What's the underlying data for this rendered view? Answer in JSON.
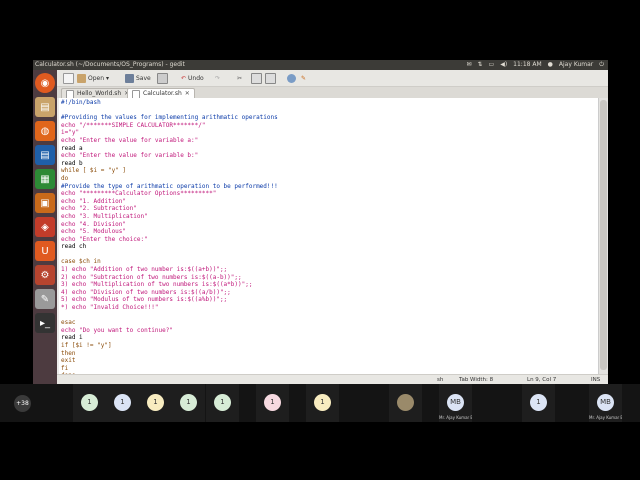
{
  "window": {
    "title": "Calculator.sh (~/Documents/OS_Programs) - gedit",
    "clock": "11:18 AM",
    "user": "Ajay Kumar"
  },
  "toolbar": {
    "open_label": "Open",
    "save_label": "Save",
    "undo_label": "Undo"
  },
  "tabs": [
    {
      "label": "Hello_World.sh"
    },
    {
      "label": "Calculator.sh"
    }
  ],
  "code_lines": [
    {
      "text": "#!/bin/bash",
      "cls": "c"
    },
    {
      "text": "",
      "cls": ""
    },
    {
      "text": "#Providing the values for implementing arithmatic operations",
      "cls": "c"
    },
    {
      "text": "echo \"/*******SIMPLE CALCULATOR*******/\"",
      "cls": "s"
    },
    {
      "text": "i=\"y\"",
      "cls": "s"
    },
    {
      "text": "echo \"Enter the value for variable a:\"",
      "cls": "s"
    },
    {
      "text": "read a",
      "cls": ""
    },
    {
      "text": "echo \"Enter the value for variable b:\"",
      "cls": "s"
    },
    {
      "text": "read b",
      "cls": ""
    },
    {
      "text": "while [ $i = \"y\" ]",
      "cls": "k"
    },
    {
      "text": "do",
      "cls": "k"
    },
    {
      "text": "#Provide the type of arithmatic operation to be performed!!!",
      "cls": "c"
    },
    {
      "text": "echo \"*********Calculator Options*********\"",
      "cls": "s"
    },
    {
      "text": "echo \"1. Addition\"",
      "cls": "s"
    },
    {
      "text": "echo \"2. Subtraction\"",
      "cls": "s"
    },
    {
      "text": "echo \"3. Multiplication\"",
      "cls": "s"
    },
    {
      "text": "echo \"4. Division\"",
      "cls": "s"
    },
    {
      "text": "echo \"5. Modulous\"",
      "cls": "s"
    },
    {
      "text": "echo \"Enter the choice:\"",
      "cls": "s"
    },
    {
      "text": "read ch",
      "cls": ""
    },
    {
      "text": "",
      "cls": ""
    },
    {
      "text": "case $ch in",
      "cls": "k"
    },
    {
      "text": "1) echo \"Addition of two number is:$((a+b))\";;",
      "cls": "s"
    },
    {
      "text": "2) echo \"Subtraction of two numbers is:$((a-b))\";;",
      "cls": "s"
    },
    {
      "text": "3) echo \"Multiplication of two numbers is:$((a*b))\";;",
      "cls": "s"
    },
    {
      "text": "4) echo \"Division of two numbers is:$((a/b))\";;",
      "cls": "s"
    },
    {
      "text": "5) echo \"Modulus of two numbers is:$((a%b))\";;",
      "cls": "s"
    },
    {
      "text": "*) echo \"Invalid Choice!!!\"",
      "cls": "s"
    },
    {
      "text": "",
      "cls": ""
    },
    {
      "text": "esac",
      "cls": "k"
    },
    {
      "text": "echo \"Do you want to continue?\"",
      "cls": "s"
    },
    {
      "text": "read i",
      "cls": ""
    },
    {
      "text": "if [$i != \"y\"]",
      "cls": "k"
    },
    {
      "text": "then",
      "cls": "k"
    },
    {
      "text": "exit",
      "cls": "k"
    },
    {
      "text": "fi",
      "cls": "k"
    },
    {
      "text": "done",
      "cls": "k"
    }
  ],
  "status": {
    "language": "sh",
    "tab_width": "Tab Width: 8",
    "position": "Ln 9, Col 7",
    "mode": "INS"
  },
  "participants": {
    "more_count": "+38",
    "tiles": [
      {
        "initial": "1",
        "label": "",
        "color": "#d7ecd6"
      },
      {
        "initial": "1",
        "label": "",
        "color": "#dbe4f5"
      },
      {
        "initial": "1",
        "label": "",
        "color": "#f8ecc0"
      },
      {
        "initial": "1",
        "label": "",
        "color": "#d7ecd6"
      },
      {
        "initial": "1",
        "label": "",
        "color": "#d7ecd6"
      },
      {
        "initial": "1",
        "label": "",
        "color": "#f6d9e0"
      },
      {
        "initial": "1",
        "label": "",
        "color": "#f8ecc0"
      },
      {
        "initial": "",
        "label": "",
        "color": "#9a8a6a"
      },
      {
        "initial": "MB",
        "label": "Mr. Ajay Kumar Badhan",
        "color": "#dbe4f5"
      },
      {
        "initial": "1",
        "label": "",
        "color": "#dbe4f5"
      },
      {
        "initial": "MB",
        "label": "Mr. Ajay Kumar Badhan",
        "color": "#dbe4f5"
      }
    ]
  }
}
